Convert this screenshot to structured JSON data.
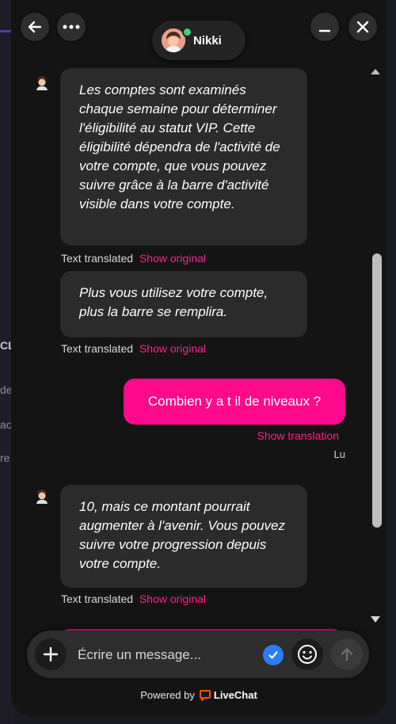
{
  "background_fragments": [
    "CL",
    "de",
    "ac",
    "re"
  ],
  "header": {
    "agent_name": "Nikki",
    "status_color": "#3fd17a"
  },
  "messages": [
    {
      "from": "agent",
      "text": "Les comptes sont examinés chaque semaine pour déterminer l'éligibilité au statut VIP. Cette éligibilité dépendra de l'activité de votre compte, que vous pouvez suivre grâce à la barre d'activité visible dans votre compte.",
      "translated_label": "Text translated",
      "show_original_label": "Show original"
    },
    {
      "from": "agent",
      "text": "Plus vous utilisez votre compte, plus la barre se remplira.",
      "translated_label": "Text translated",
      "show_original_label": "Show original"
    },
    {
      "from": "user",
      "text": "Combien y a t il de niveaux ?",
      "show_translation_label": "Show translation",
      "read_status": "Lu"
    },
    {
      "from": "agent",
      "text": "10, mais ce montant pourrait augmenter à l'avenir. Vous pouvez suivre votre progression depuis votre compte.",
      "translated_label": "Text translated",
      "show_original_label": "Show original"
    }
  ],
  "composer": {
    "placeholder": "Écrire un message..."
  },
  "footer": {
    "powered_by": "Powered by",
    "brand": "LiveChat"
  },
  "colors": {
    "accent": "#ff0a8a",
    "bubble_bg": "#2b2b2b",
    "check": "#2a7df0",
    "brand_icon": "#ff5100"
  }
}
